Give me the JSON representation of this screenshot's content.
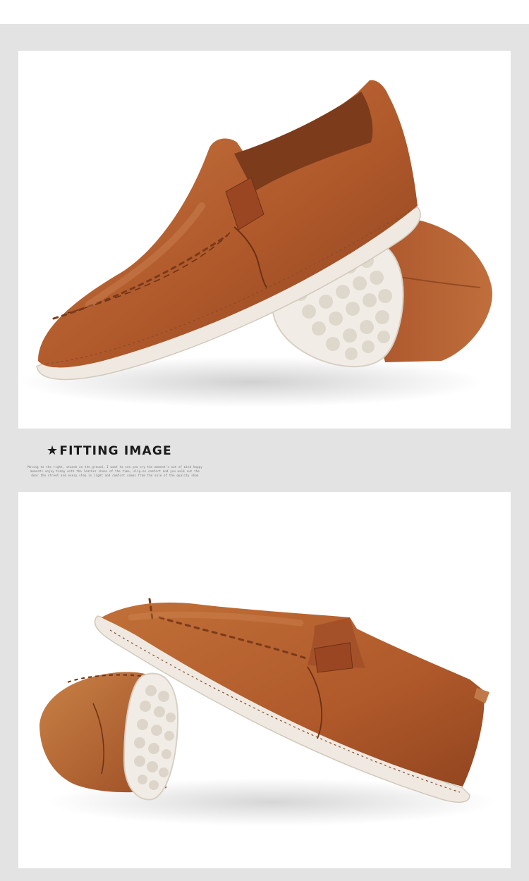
{
  "section": {
    "star_icon": "black-star",
    "heading": "FITTING IMAGE",
    "blurb": "Moving to the right, stands on the ground, I want to see you cry the moment's out of mind happy moments enjoy today with the leather shoes of the time, slip-on comfort and you walk out the door the street and every step is light and comfort comes from the sole of the quality shoe"
  },
  "photos": [
    {
      "name": "top-shoe-photo",
      "subject": "brown leather slip-on loafers, pair, one upright and one tilted showing white sole"
    },
    {
      "name": "bottom-shoe-photo",
      "subject": "brown leather slip-on loafers, pair, mirrored view showing white sole"
    }
  ],
  "colors": {
    "leather": "#b25f30",
    "leather_dark": "#7a3a19",
    "sole": "#eee8e0",
    "background": "#e3e3e3"
  }
}
